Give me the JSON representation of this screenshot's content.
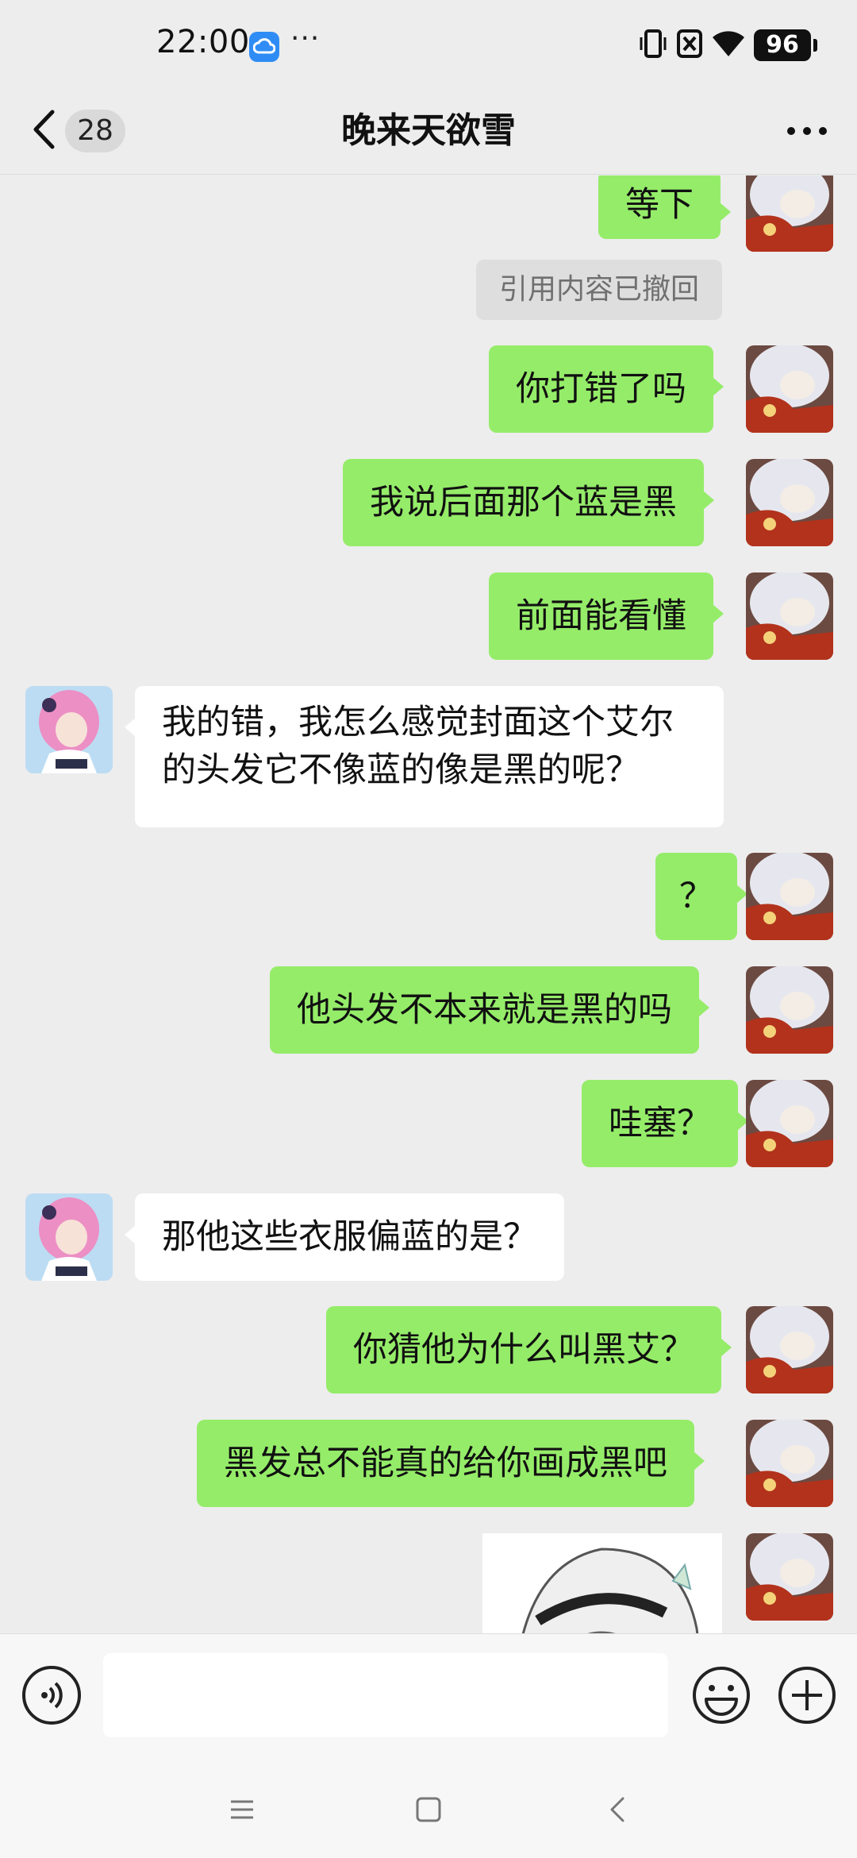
{
  "status_bar": {
    "time": "22:00",
    "dots": "···",
    "battery": "96",
    "icons": [
      "cloud-icon",
      "vibrate-icon",
      "no-sim-icon",
      "wifi-icon",
      "battery-icon"
    ]
  },
  "header": {
    "back_icon": "chevron-left-icon",
    "unread_count": "28",
    "title": "晚来天欲雪",
    "more_icon": "more-dots-icon"
  },
  "messages": [
    {
      "side": "out",
      "text": "等下"
    },
    {
      "side": "system",
      "text": "引用内容已撤回"
    },
    {
      "side": "out",
      "text": "你打错了吗"
    },
    {
      "side": "out",
      "text": "我说后面那个蓝是黑"
    },
    {
      "side": "out",
      "text": "前面能看懂"
    },
    {
      "side": "in",
      "text": "我的错，我怎么感觉封面这个艾尔的头发它不像蓝的像是黑的呢？"
    },
    {
      "side": "out",
      "text": "？"
    },
    {
      "side": "out",
      "text": "他头发不本来就是黑的吗"
    },
    {
      "side": "out",
      "text": "哇塞？"
    },
    {
      "side": "in",
      "text": "那他这些衣服偏蓝的是？"
    },
    {
      "side": "out",
      "text": "你猜他为什么叫黑艾？"
    },
    {
      "side": "out",
      "text": "黑发总不能真的给你画成黑吧"
    },
    {
      "side": "out",
      "type": "sticker",
      "text": ""
    }
  ],
  "input_bar": {
    "voice_icon": "voice-icon",
    "input_value": "",
    "emoji_icon": "emoji-icon",
    "plus_icon": "plus-icon"
  },
  "system_nav": {
    "icons": [
      "menu-icon",
      "home-icon",
      "back-icon"
    ]
  },
  "colors": {
    "background": "#ededed",
    "outgoing_bubble": "#95ec69",
    "incoming_bubble": "#ffffff",
    "badge": "#d9d9d9",
    "cloud_icon": "#2f8cf5"
  }
}
